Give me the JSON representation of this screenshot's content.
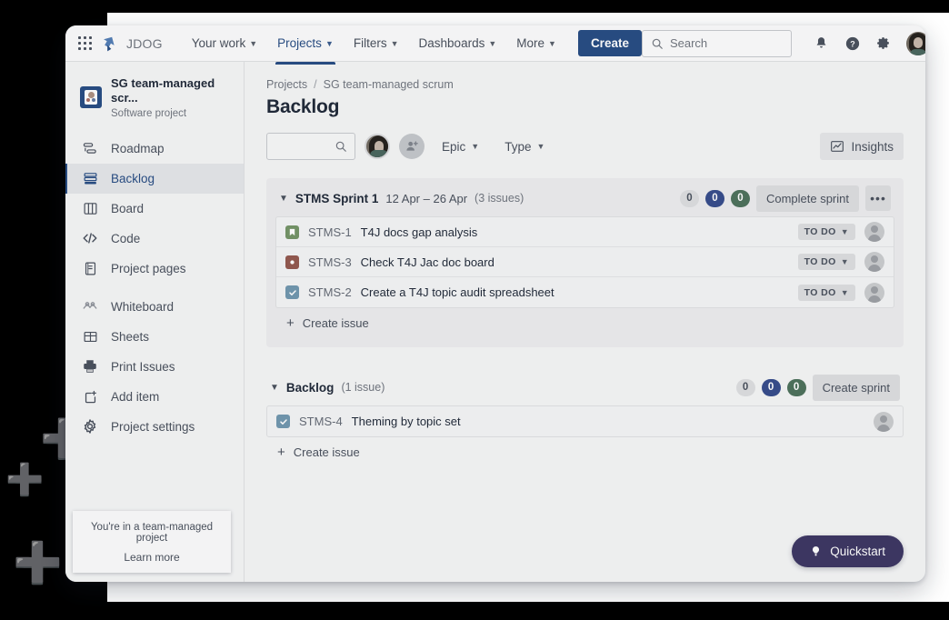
{
  "topnav": {
    "app_switcher_icon": "grid-apps-icon",
    "logo_icon": "jira-logo-icon",
    "brand": "JDOG",
    "items": [
      {
        "label": "Your work",
        "icon": "chevron-down-icon",
        "active": false
      },
      {
        "label": "Projects",
        "icon": "chevron-down-icon",
        "active": true
      },
      {
        "label": "Filters",
        "icon": "chevron-down-icon",
        "active": false
      },
      {
        "label": "Dashboards",
        "icon": "chevron-down-icon",
        "active": false
      },
      {
        "label": "More",
        "icon": "chevron-down-icon",
        "active": false
      }
    ],
    "create_label": "Create",
    "search_placeholder": "Search",
    "search_value": "",
    "search_icon": "search-icon",
    "notifications_icon": "bell-icon",
    "help_icon": "question-circle-icon",
    "settings_icon": "gear-icon",
    "profile_icon": "user-avatar"
  },
  "sidebar": {
    "project_name": "SG team-managed scr...",
    "project_type": "Software project",
    "project_icon": "project-avatar-icon",
    "items": [
      {
        "label": "Roadmap",
        "icon": "roadmap-icon",
        "selected": false
      },
      {
        "label": "Backlog",
        "icon": "backlog-icon",
        "selected": true
      },
      {
        "label": "Board",
        "icon": "board-icon",
        "selected": false
      },
      {
        "label": "Code",
        "icon": "code-icon",
        "selected": false
      },
      {
        "label": "Project pages",
        "icon": "page-icon",
        "selected": false
      },
      {
        "label": "Whiteboard",
        "icon": "whiteboard-icon",
        "selected": false
      },
      {
        "label": "Sheets",
        "icon": "sheets-icon",
        "selected": false
      },
      {
        "label": "Print Issues",
        "icon": "printer-icon",
        "selected": false
      },
      {
        "label": "Add item",
        "icon": "add-item-icon",
        "selected": false
      },
      {
        "label": "Project settings",
        "icon": "gear-icon",
        "selected": false
      }
    ],
    "tooltip": {
      "text": "You're in a team-managed project",
      "link": "Learn more"
    }
  },
  "main": {
    "breadcrumb": {
      "root": "Projects",
      "separator": "/",
      "current": "SG team-managed scrum"
    },
    "page_title": "Backlog",
    "toolbar": {
      "search_value": "",
      "search_placeholder": "",
      "search_icon": "search-icon",
      "avatar_icon": "user-avatar",
      "add_people_icon": "add-person-icon",
      "epic_label": "Epic",
      "type_label": "Type",
      "chevron_icon": "chevron-down-icon",
      "insights_label": "Insights",
      "insights_icon": "insights-chart-icon"
    },
    "sections": [
      {
        "chevron_icon": "chevron-down-icon",
        "title": "STMS Sprint 1",
        "dates": "12 Apr – 26 Apr",
        "count": "(3 issues)",
        "pills": [
          {
            "value": "0",
            "color": "#dcdee3",
            "kind": "grey"
          },
          {
            "value": "0",
            "color": "#1d4ed8",
            "kind": "blue"
          },
          {
            "value": "0",
            "color": "#2e7d4f",
            "kind": "green"
          }
        ],
        "action_label": "Complete sprint",
        "more_icon": "more-horizontal-icon",
        "has_more": true,
        "issues": [
          {
            "type": "story",
            "type_icon": "story-bookmark-icon",
            "glyph": "▐",
            "key": "STMS-1",
            "summary": "T4J docs gap analysis",
            "status": "TO DO",
            "status_chevron": "chevron-down-icon",
            "assignee_icon": "avatar-placeholder-icon"
          },
          {
            "type": "bug",
            "type_icon": "bug-circle-icon",
            "glyph": "●",
            "key": "STMS-3",
            "summary": "Check T4J Jac doc board",
            "status": "TO DO",
            "status_chevron": "chevron-down-icon",
            "assignee_icon": "avatar-placeholder-icon"
          },
          {
            "type": "task",
            "type_icon": "task-check-icon",
            "glyph": "✓",
            "key": "STMS-2",
            "summary": "Create a T4J topic audit spreadsheet",
            "status": "TO DO",
            "status_chevron": "chevron-down-icon",
            "assignee_icon": "avatar-placeholder-icon"
          }
        ],
        "create_issue_label": "Create issue",
        "create_issue_icon": "plus-icon"
      },
      {
        "chevron_icon": "chevron-down-icon",
        "title": "Backlog",
        "dates": "",
        "count": "(1 issue)",
        "pills": [
          {
            "value": "0",
            "color": "#dcdee3",
            "kind": "grey"
          },
          {
            "value": "0",
            "color": "#1d4ed8",
            "kind": "blue"
          },
          {
            "value": "0",
            "color": "#2e7d4f",
            "kind": "green"
          }
        ],
        "action_label": "Create sprint",
        "more_icon": "",
        "has_more": false,
        "issues": [
          {
            "type": "task",
            "type_icon": "task-check-icon",
            "glyph": "✓",
            "key": "STMS-4",
            "summary": "Theming by topic set",
            "status": "",
            "status_chevron": "",
            "assignee_icon": "avatar-placeholder-icon"
          }
        ],
        "create_issue_label": "Create issue",
        "create_issue_icon": "plus-icon"
      }
    ],
    "quickstart": {
      "label": "Quickstart",
      "icon": "lightbulb-icon"
    }
  },
  "theme": {
    "accent_blue": "#0052cc",
    "purple": "#403294",
    "story_green": "#59a13f",
    "bug_red": "#cc4b37",
    "task_blue": "#4b9fd5",
    "pill_blue": "#1d4ed8",
    "pill_green": "#2e7d4f"
  }
}
